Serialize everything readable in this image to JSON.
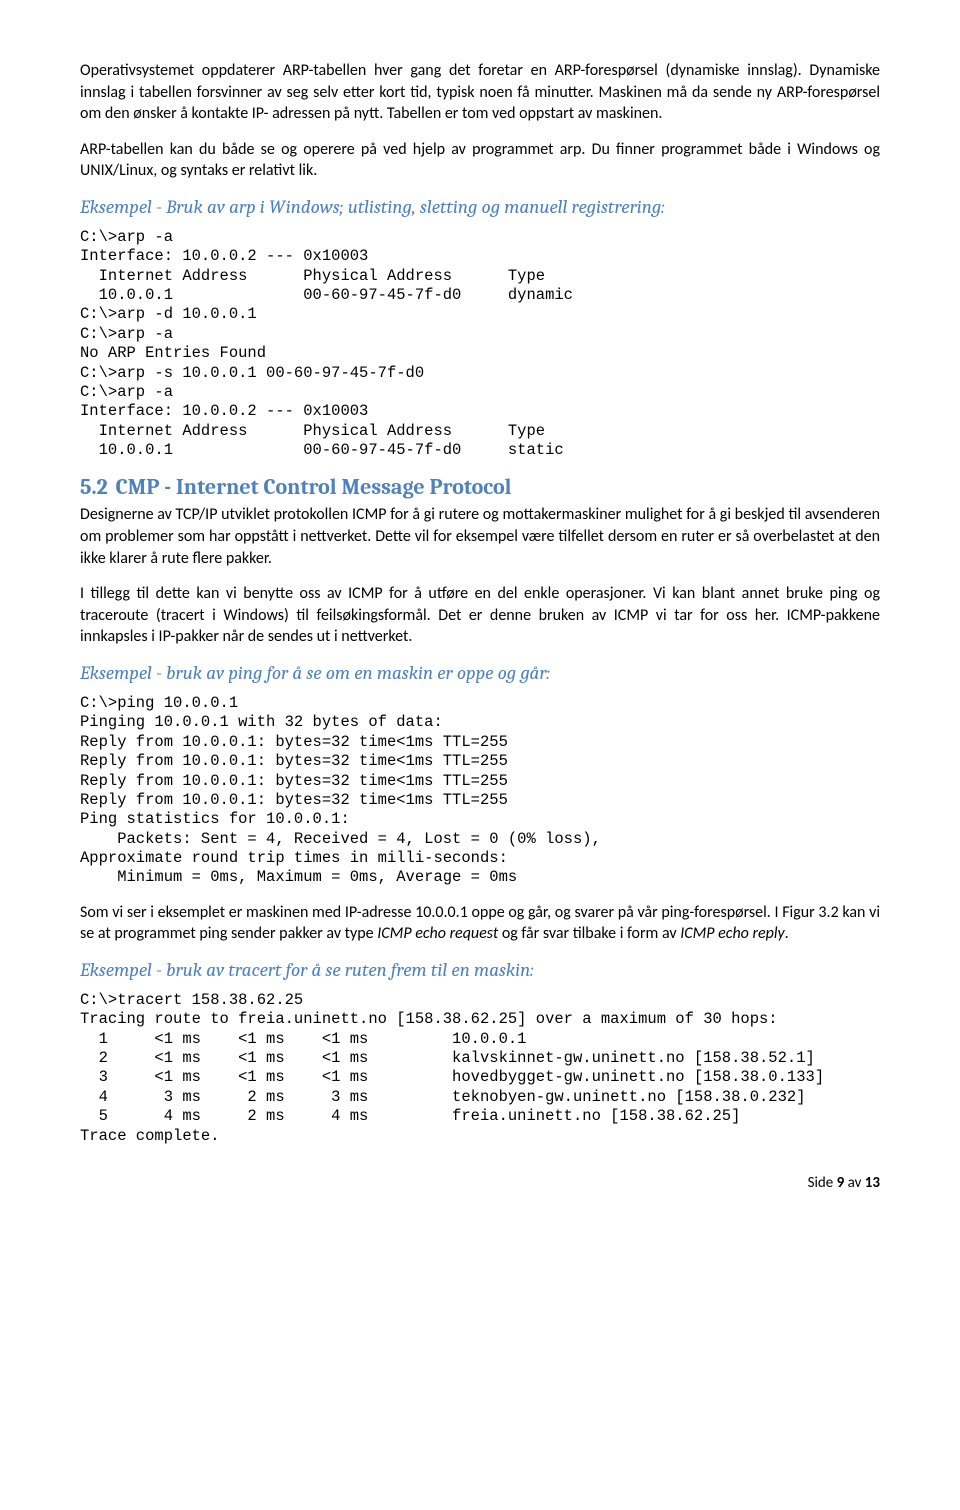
{
  "para1": "Operativsystemet oppdaterer ARP-tabellen hver gang det foretar en ARP-forespørsel (dynamiske innslag). Dynamiske innslag i tabellen forsvinner av seg selv etter kort tid, typisk noen få minutter. Maskinen må da sende ny ARP-forespørsel om den ønsker å kontakte IP- adressen på nytt. Tabellen er tom ved oppstart av maskinen.",
  "para2": "ARP-tabellen kan du både se og operere på ved hjelp av programmet arp. Du finner programmet både i Windows og UNIX/Linux, og syntaks er relativt lik.",
  "ex1_title": "Eksempel - Bruk av arp i Windows; utlisting, sletting og manuell registrering:",
  "code1": "C:\\>arp -a\nInterface: 10.0.0.2 --- 0x10003\n  Internet Address      Physical Address      Type\n  10.0.0.1              00-60-97-45-7f-d0     dynamic\nC:\\>arp -d 10.0.0.1\nC:\\>arp -a\nNo ARP Entries Found\nC:\\>arp -s 10.0.0.1 00-60-97-45-7f-d0\nC:\\>arp -a\nInterface: 10.0.0.2 --- 0x10003\n  Internet Address      Physical Address      Type\n  10.0.0.1              00-60-97-45-7f-d0     static",
  "h2_num": "5.2",
  "h2_text": "CMP - Internet Control Message Protocol",
  "para3": "Designerne av TCP/IP utviklet protokollen ICMP for å gi rutere og mottakermaskiner mulighet for å gi beskjed til avsenderen om problemer som har oppstått i nettverket. Dette vil for eksempel være tilfellet dersom en ruter er så overbelastet at den ikke klarer å rute flere pakker.",
  "para4": "I tillegg til dette kan vi benytte oss av ICMP for å utføre en del enkle operasjoner. Vi kan blant annet bruke ping og traceroute (tracert i Windows) til feilsøkingsformål. Det er denne bruken av ICMP vi tar for oss her. ICMP-pakkene innkapsles i IP-pakker når de sendes ut i nettverket.",
  "ex2_title": "Eksempel - bruk av ping for å se om en maskin er oppe og går:",
  "code2": "C:\\>ping 10.0.0.1\nPinging 10.0.0.1 with 32 bytes of data:\nReply from 10.0.0.1: bytes=32 time<1ms TTL=255\nReply from 10.0.0.1: bytes=32 time<1ms TTL=255\nReply from 10.0.0.1: bytes=32 time<1ms TTL=255\nReply from 10.0.0.1: bytes=32 time<1ms TTL=255\nPing statistics for 10.0.0.1:\n    Packets: Sent = 4, Received = 4, Lost = 0 (0% loss),\nApproximate round trip times in milli-seconds:\n    Minimum = 0ms, Maximum = 0ms, Average = 0ms",
  "para5_a": "Som vi ser i eksemplet er maskinen med IP-adresse 10.0.0.1 oppe og går, og svarer på vår ping-forespørsel. I Figur 3.2 kan vi se at programmet ping sender pakker av type ",
  "para5_i1": "ICMP echo request",
  "para5_b": " og får svar tilbake i form av ",
  "para5_i2": "ICMP echo reply",
  "para5_c": ".",
  "ex3_title": "Eksempel - bruk av tracert for å se ruten frem til en maskin:",
  "code3": "C:\\>tracert 158.38.62.25\nTracing route to freia.uninett.no [158.38.62.25] over a maximum of 30 hops:\n  1     <1 ms    <1 ms    <1 ms         10.0.0.1\n  2     <1 ms    <1 ms    <1 ms         kalvskinnet-gw.uninett.no [158.38.52.1]\n  3     <1 ms    <1 ms    <1 ms         hovedbygget-gw.uninett.no [158.38.0.133]\n  4      3 ms     2 ms     3 ms         teknobyen-gw.uninett.no [158.38.0.232]\n  5      4 ms     2 ms     4 ms         freia.uninett.no [158.38.62.25]\nTrace complete.",
  "footer_a": "Side ",
  "footer_b": "9",
  "footer_c": " av ",
  "footer_d": "13"
}
